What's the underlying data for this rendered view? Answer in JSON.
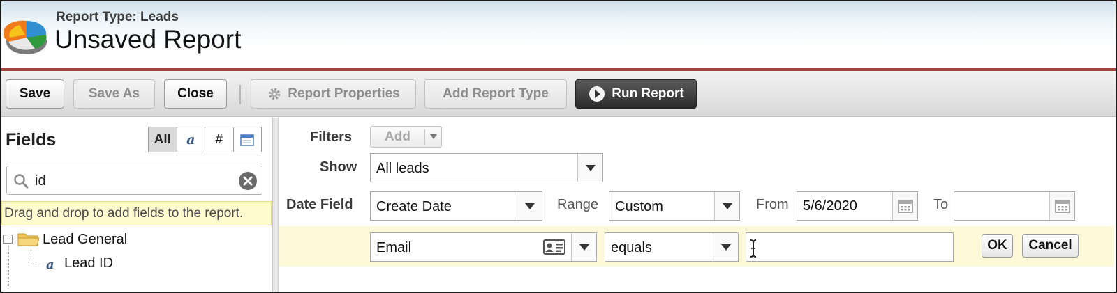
{
  "header": {
    "report_type": "Report Type: Leads",
    "title": "Unsaved Report",
    "logo_icon": "report-pie-logo-icon"
  },
  "toolbar": {
    "save": "Save",
    "save_as": "Save As",
    "close": "Close",
    "report_properties": "Report Properties",
    "add_report_type": "Add Report Type",
    "run_report": "Run Report",
    "report_properties_icon": "gear-icon",
    "run_report_icon": "play-icon"
  },
  "fields_panel": {
    "title": "Fields",
    "filter_all": "All",
    "filter_text": "a",
    "filter_number": "#",
    "filter_date_icon": "calendar-icon",
    "search_value": "id",
    "hint": "Drag and drop to add fields to the report.",
    "tree": {
      "folder_label": "Lead General",
      "items": [
        "Lead ID"
      ]
    }
  },
  "filters": {
    "filters_label": "Filters",
    "add_label": "Add",
    "show_label": "Show",
    "show_value": "All leads",
    "date_field_label": "Date Field",
    "date_field_value": "Create Date",
    "range_label": "Range",
    "range_value": "Custom",
    "from_label": "From",
    "from_value": "5/6/2020",
    "to_label": "To",
    "to_value": "",
    "new_filter": {
      "field_value": "Email",
      "operator_value": "equals",
      "value": "",
      "ok": "OK",
      "cancel": "Cancel"
    }
  },
  "colors": {
    "header_rule": "#a1463f",
    "hint_bg": "#fffbd0",
    "filter_row_bg": "#fdf9d9",
    "run_button_bg": "#333333"
  }
}
